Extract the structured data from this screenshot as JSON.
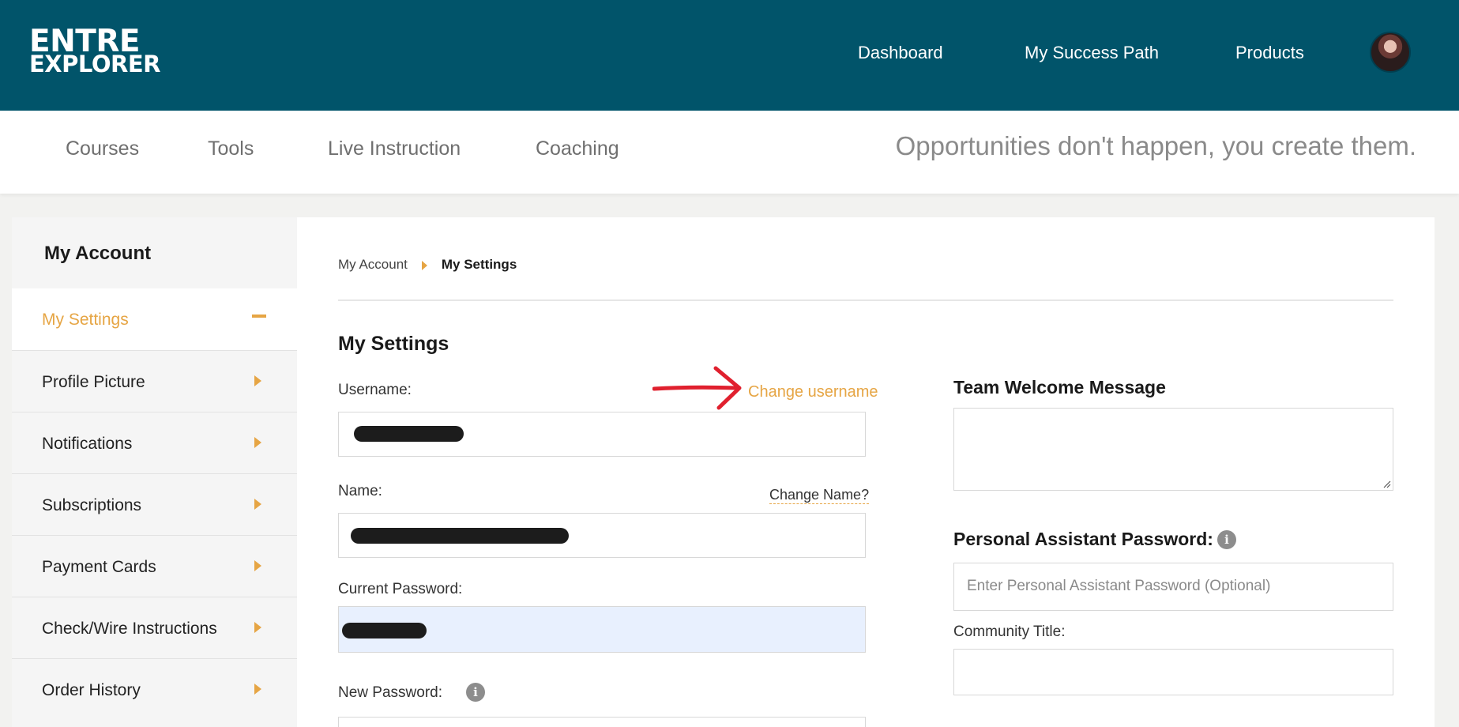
{
  "header": {
    "logo_line1": "ENTRE",
    "logo_line2": "EXPLORER",
    "nav": [
      "Dashboard",
      "My Success Path",
      "Products"
    ]
  },
  "subnav": {
    "items": [
      "Courses",
      "Tools",
      "Live Instruction",
      "Coaching"
    ],
    "tagline": "Opportunities don't happen, you create them."
  },
  "sidebar": {
    "title": "My Account",
    "items": [
      {
        "label": "My Settings",
        "active": true
      },
      {
        "label": "Profile Picture"
      },
      {
        "label": "Notifications"
      },
      {
        "label": "Subscriptions"
      },
      {
        "label": "Payment Cards"
      },
      {
        "label": "Check/Wire Instructions"
      },
      {
        "label": "Order History"
      }
    ]
  },
  "breadcrumb": {
    "root": "My Account",
    "current": "My Settings"
  },
  "settings": {
    "title": "My Settings",
    "username_label": "Username:",
    "change_username": "Change username",
    "name_label": "Name:",
    "change_name": "Change Name?",
    "current_password_label": "Current Password:",
    "new_password_label": "New Password:",
    "team_welcome_title": "Team Welcome Message",
    "pa_password_title": "Personal Assistant Password:",
    "pa_password_placeholder": "Enter Personal Assistant Password (Optional)",
    "community_title_label": "Community Title:"
  },
  "colors": {
    "header_bg": "#01546a",
    "accent": "#e6a544",
    "annotation_arrow": "#e0202e"
  }
}
